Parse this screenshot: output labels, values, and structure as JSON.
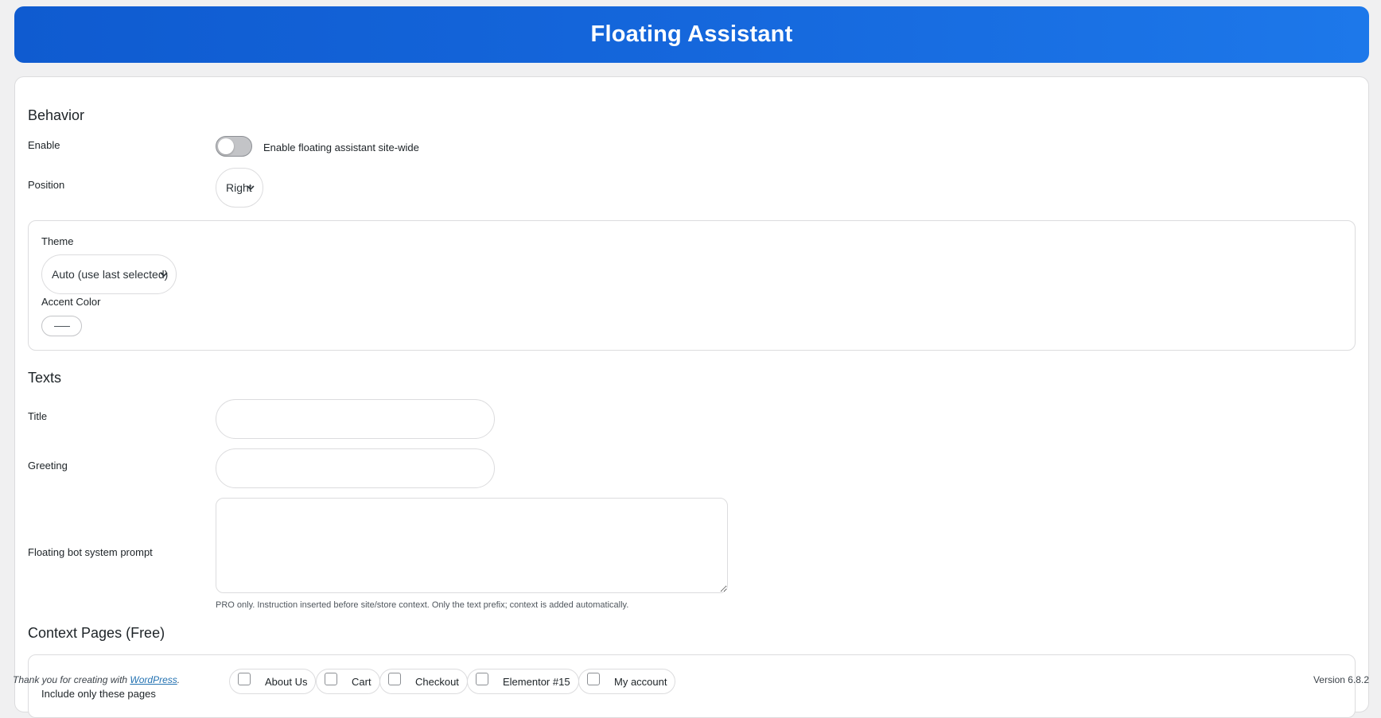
{
  "header": {
    "title": "Floating Assistant"
  },
  "behavior": {
    "section_title": "Behavior",
    "enable_label": "Enable",
    "enable_toggle_text": "Enable floating assistant site-wide",
    "enable_value": false,
    "position_label": "Position",
    "position_value": "Right",
    "theme_label": "Theme",
    "theme_value": "Auto (use last selected)",
    "accent_label": "Accent Color"
  },
  "texts": {
    "section_title": "Texts",
    "title_label": "Title",
    "title_value": "",
    "greeting_label": "Greeting",
    "greeting_value": "",
    "prompt_label": "Floating bot system prompt",
    "prompt_value": "",
    "prompt_help": "PRO only. Instruction inserted before site/store context. Only the text prefix; context is added automatically."
  },
  "context_pages": {
    "section_title": "Context Pages (Free)",
    "include_label": "Include only these pages",
    "pages": [
      "About Us",
      "Cart",
      "Checkout",
      "Elementor #15",
      "My account"
    ]
  },
  "footer": {
    "thanks_prefix": "Thank you for creating with ",
    "thanks_link": "WordPress",
    "thanks_suffix": ".",
    "version": "Version 6.8.2"
  },
  "colors": {
    "header_start": "#0f5bd0",
    "header_end": "#1d78ea",
    "link": "#2271b1",
    "background": "#f0f0f1"
  }
}
